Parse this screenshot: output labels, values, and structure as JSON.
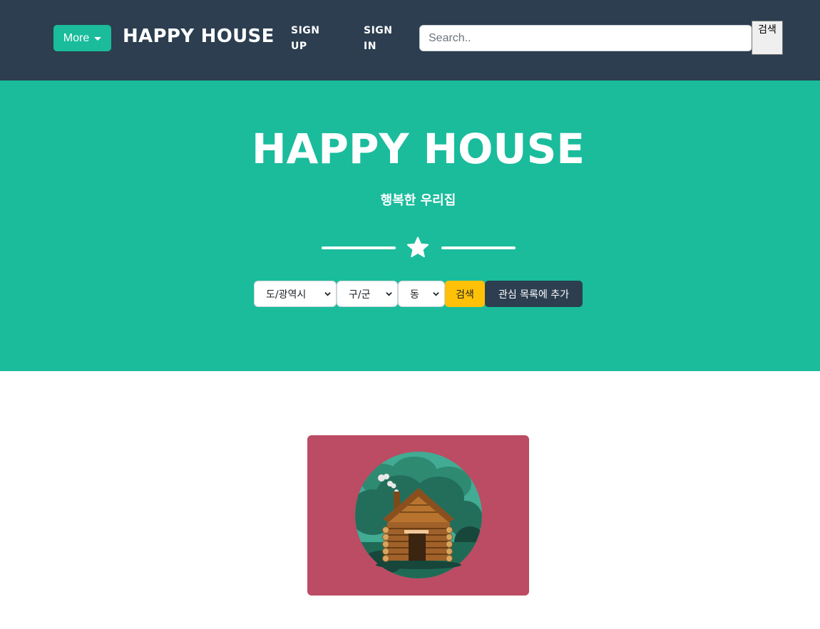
{
  "navbar": {
    "more_label": "More",
    "brand": "HAPPY HOUSE",
    "links": [
      "SIGN UP",
      "SIGN IN"
    ],
    "search_placeholder": "Search..",
    "search_button": "검색"
  },
  "hero": {
    "title": "HAPPY HOUSE",
    "subtitle": "행복한 우리집",
    "divider_icon": "star-icon",
    "selects": [
      {
        "selected": "도/광역시"
      },
      {
        "selected": "구/군"
      },
      {
        "selected": "동"
      }
    ],
    "search_button": "검색",
    "favorite_button": "관심 목록에 추가"
  },
  "portfolio": {
    "card_image": "log-cabin-illustration"
  },
  "colors": {
    "navbar_bg": "#2c3e50",
    "primary": "#1abc9c",
    "warning": "#ffc107",
    "card_bg": "#bb4c63"
  }
}
